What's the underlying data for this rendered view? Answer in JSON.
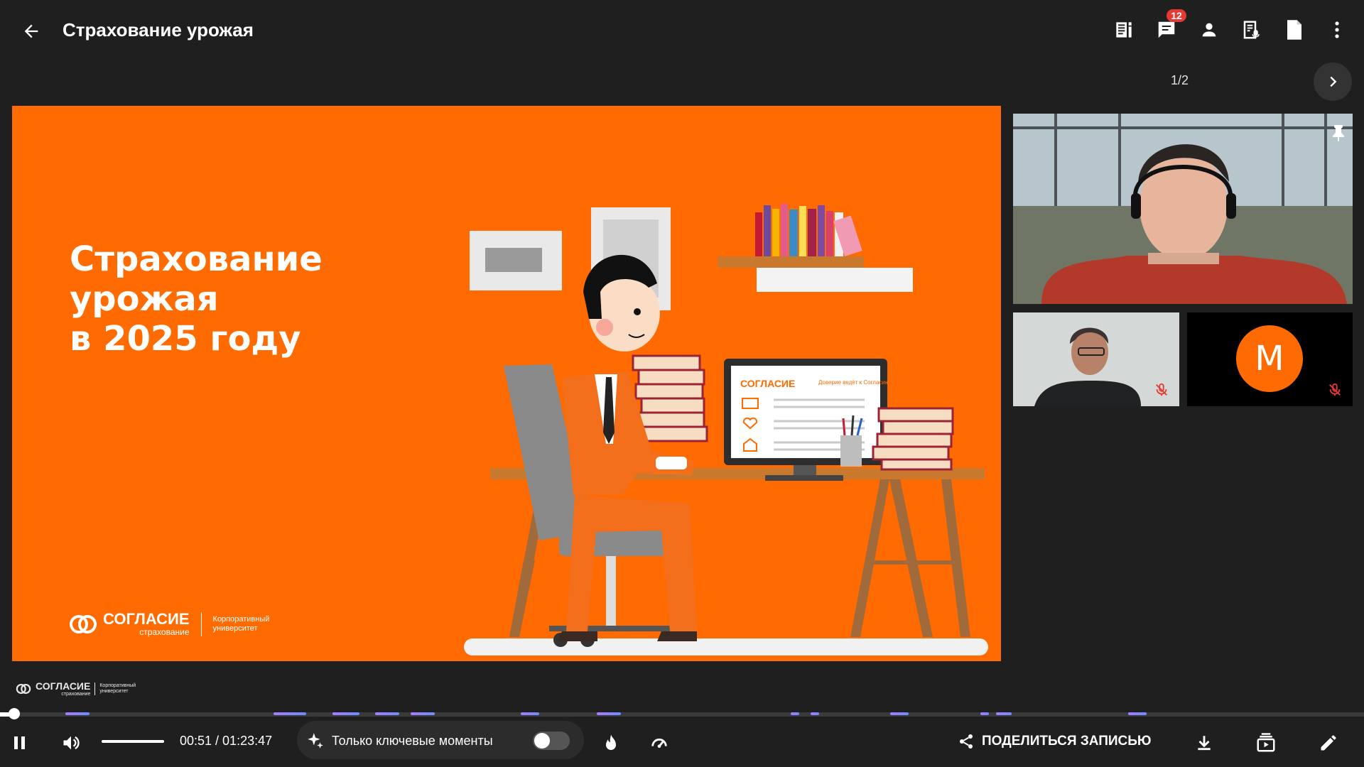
{
  "header": {
    "title": "Страхование урожая",
    "chat_badge": "12",
    "icons": [
      "notes-icon",
      "chat-icon",
      "participants-icon",
      "transcript-icon",
      "document-icon",
      "more-icon"
    ]
  },
  "pager": {
    "label": "1/2"
  },
  "slide": {
    "title_line1": "Страхование урожая",
    "title_line2": "в 2025 году",
    "brand_name": "СОГЛАСИЕ",
    "brand_sub": "страхование",
    "brand_right": "Корпоративный университет",
    "monitor_brand": "СОГЛАСИЕ",
    "monitor_tagline": "Доверие ведёт к Согласию"
  },
  "participants": {
    "avatar_letter": "M"
  },
  "watermark": {
    "name": "СОГЛАСИЕ",
    "sub": "страхование",
    "right": "Корпоративный университет"
  },
  "player": {
    "time": "00:51 / 01:23:47",
    "progress_fraction": 0.0102,
    "key_moments_label": "Только ключевые моменты",
    "key_moments_enabled": false,
    "share_label": "ПОДЕЛИТЬСЯ ЗАПИСЬЮ"
  },
  "colors": {
    "accent": "#ff6b00",
    "badge": "#e53935",
    "background": "#1f1f1f"
  }
}
